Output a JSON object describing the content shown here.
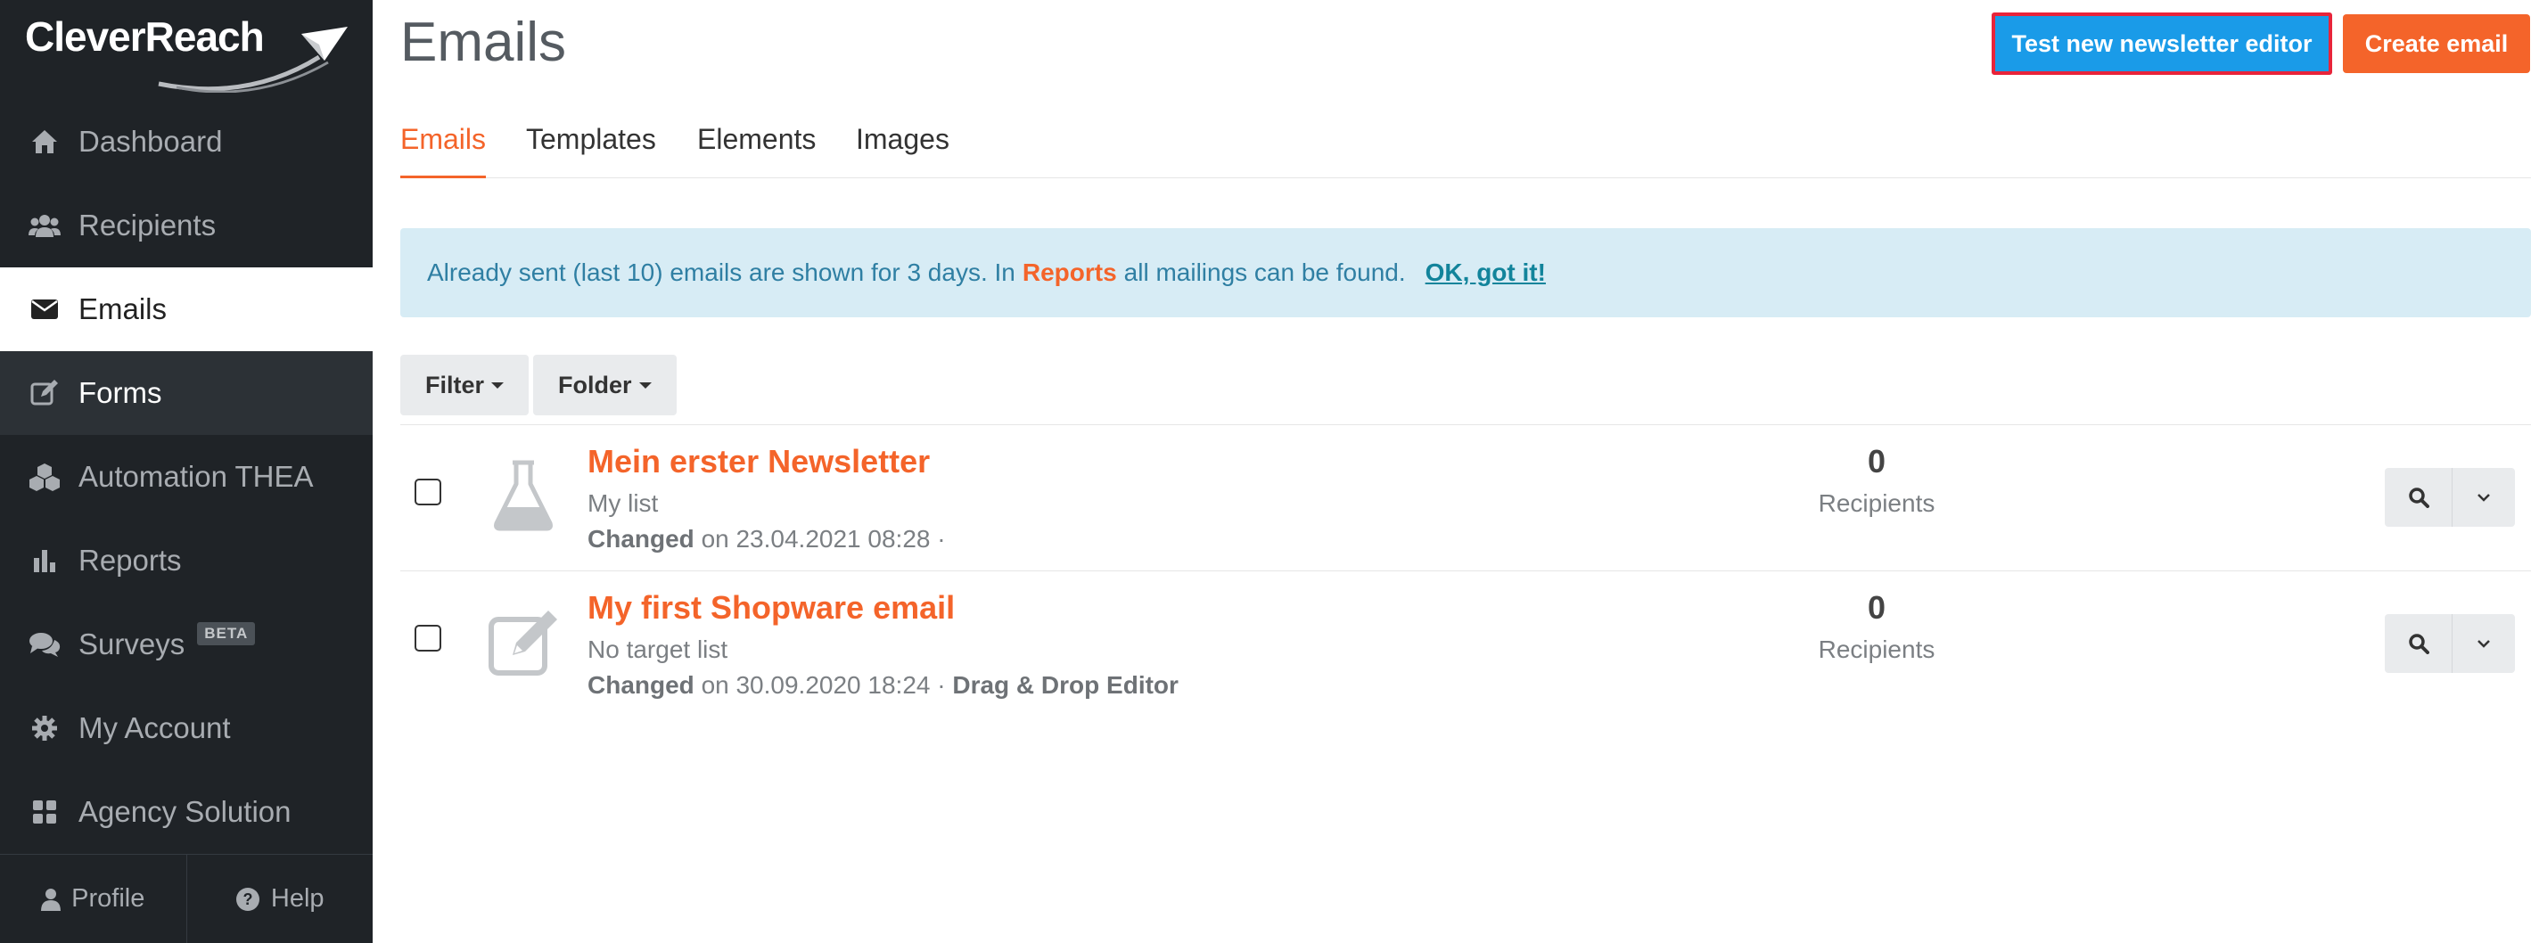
{
  "brand": {
    "logo_text": "CleverReach"
  },
  "sidebar": {
    "items": [
      {
        "label": "Dashboard",
        "icon": "home-icon"
      },
      {
        "label": "Recipients",
        "icon": "users-icon"
      },
      {
        "label": "Emails",
        "icon": "envelope-icon",
        "state": "active"
      },
      {
        "label": "Forms",
        "icon": "edit-icon",
        "state": "hover"
      },
      {
        "label": "Automation THEA",
        "icon": "cubes-icon"
      },
      {
        "label": "Reports",
        "icon": "bar-chart-icon"
      },
      {
        "label": "Surveys",
        "icon": "comments-icon",
        "badge": "BETA"
      },
      {
        "label": "My Account",
        "icon": "gear-icon"
      },
      {
        "label": "Agency Solution",
        "icon": "grid-icon"
      }
    ],
    "bottom": {
      "profile": "Profile",
      "help": "Help"
    }
  },
  "header": {
    "title": "Emails",
    "test_editor_button": "Test new newsletter editor",
    "create_button": "Create email"
  },
  "tabs": [
    {
      "label": "Emails",
      "active": true
    },
    {
      "label": "Templates"
    },
    {
      "label": "Elements"
    },
    {
      "label": "Images"
    }
  ],
  "alert": {
    "text_before": "Already sent (last 10) emails are shown for 3 days. In",
    "highlight": "Reports",
    "text_after": "all mailings can be found.",
    "dismiss": "OK, got it!"
  },
  "toolbar": {
    "filter": "Filter",
    "folder": "Folder"
  },
  "emails": [
    {
      "title": "Mein erster Newsletter",
      "list": "My list",
      "changed_label": "Changed",
      "changed_on": "on 23.04.2021 08:28 ·",
      "editor": "",
      "icon": "flask-icon",
      "recipients": "0",
      "recipients_label": "Recipients"
    },
    {
      "title": "My first Shopware email",
      "list": "No target list",
      "changed_label": "Changed",
      "changed_on": "on 30.09.2020 18:24 ·",
      "editor": "Drag & Drop Editor",
      "icon": "edit-icon",
      "recipients": "0",
      "recipients_label": "Recipients"
    }
  ],
  "colors": {
    "sidebar_bg": "#1f2327",
    "accent_orange": "#f4642a",
    "primary_blue": "#1a9be8",
    "highlight_border": "#e8243a",
    "alert_bg": "#d7ecf5"
  }
}
